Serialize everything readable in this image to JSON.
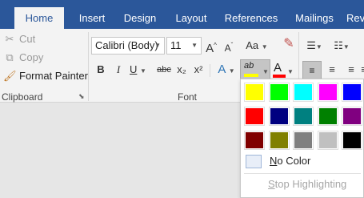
{
  "tabs": [
    "Home",
    "Insert",
    "Design",
    "Layout",
    "References",
    "Mailings",
    "Rev"
  ],
  "clipboard": {
    "cut": "Cut",
    "copy": "Copy",
    "format_painter": "Format Painter",
    "group_label": "Clipboard"
  },
  "font": {
    "family": "Calibri (Body)",
    "size": "11",
    "group_label": "Font",
    "bold": "B",
    "italic": "I",
    "underline": "U",
    "strike": "abc",
    "sub": "x₂",
    "sup": "x²",
    "grow": "A",
    "shrink": "A",
    "case": "Aa",
    "effects": "A",
    "highlight": "ab",
    "font_color": "A"
  },
  "highlight_menu": {
    "colors": [
      "#ffff00",
      "#00ff00",
      "#00ffff",
      "#ff00ff",
      "#0000ff",
      "#ff0000",
      "#000080",
      "#008080",
      "#008000",
      "#800080",
      "#800000",
      "#808000",
      "#808080",
      "#c0c0c0",
      "#000000"
    ],
    "no_color": "No Color",
    "stop": "Stop Highlighting"
  },
  "colors": {
    "accent": "#2b579a",
    "highlight_bar": "#ffff00",
    "font_color_bar": "#ff0000"
  }
}
